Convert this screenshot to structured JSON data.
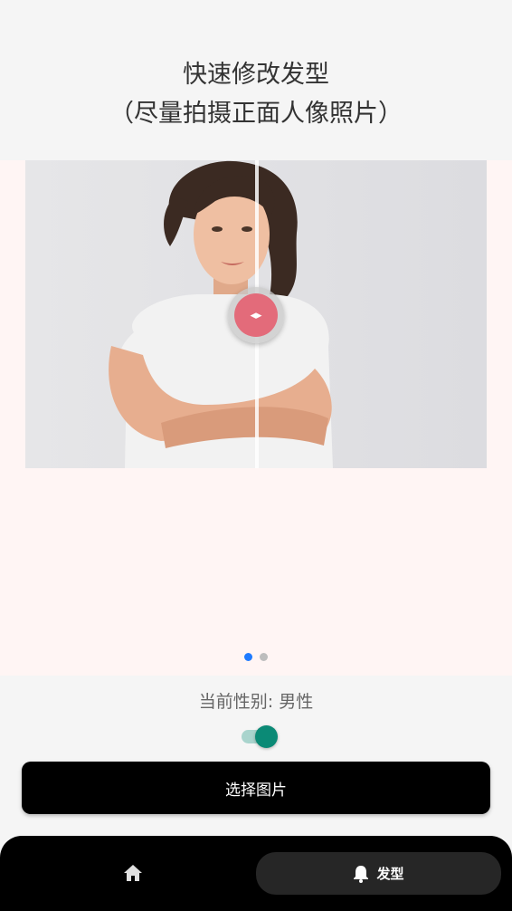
{
  "header": {
    "title_line1": "快速修改发型",
    "title_line2": "（尽量拍摄正面人像照片）"
  },
  "carousel": {
    "handle_glyph": "◂▸",
    "dots": [
      {
        "active": true
      },
      {
        "active": false
      }
    ],
    "active_dot_color": "#1e7bff"
  },
  "controls": {
    "gender_text": "当前性别: 男性",
    "switch_on": true,
    "switch_color": "#0b8a76",
    "select_button": "选择图片"
  },
  "bottom_nav": {
    "home_icon": "home-icon",
    "hair_icon": "bell-icon",
    "hair_label": "发型"
  }
}
